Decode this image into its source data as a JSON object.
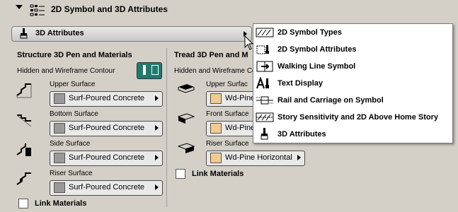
{
  "header": {
    "title": "2D Symbol and 3D Attributes"
  },
  "selector": {
    "label": "3D Attributes"
  },
  "left": {
    "title": "Structure 3D Pen and Materials",
    "contour_label": "Hidden and Wireframe Contour",
    "items": [
      {
        "label": "Upper Surface",
        "value": "Surf-Poured Concrete"
      },
      {
        "label": "Bottom Surface",
        "value": "Surf-Poured Concrete"
      },
      {
        "label": "Side Surface",
        "value": "Surf-Poured Concrete"
      },
      {
        "label": "Riser Surface",
        "value": "Surf-Poured Concrete"
      }
    ],
    "link_label": "Link Materials",
    "swatch_color": "#9a9a9a"
  },
  "right": {
    "title": "Tread 3D Pen and M",
    "contour_label": "Hidden and Wireframe Co",
    "items": [
      {
        "label": "Upper Surfac",
        "value": "Wd-Pine"
      },
      {
        "label": "Front Surface",
        "value": "Wd-Pine"
      },
      {
        "label": "Riser Surface",
        "value": "Wd-Pine Horizontal"
      }
    ],
    "link_label": "Link Materials",
    "swatch_color": "#f2cc8f"
  },
  "menu": {
    "items": [
      {
        "label": "2D Symbol Types",
        "icon": "symbol-types-icon"
      },
      {
        "label": "2D Symbol Attributes",
        "icon": "symbol-attributes-icon"
      },
      {
        "label": "Walking Line Symbol",
        "icon": "walking-line-icon"
      },
      {
        "label": "Text Display",
        "icon": "text-display-icon"
      },
      {
        "label": "Rail and Carriage on Symbol",
        "icon": "rail-carriage-icon"
      },
      {
        "label": "Story Sensitivity and 2D Above Home Story",
        "icon": "story-sensitivity-icon"
      },
      {
        "label": "3D Attributes",
        "icon": "brush-icon"
      }
    ]
  },
  "colors": {
    "toggle_on": "#1e7b70",
    "background": "#d4d0c8"
  }
}
